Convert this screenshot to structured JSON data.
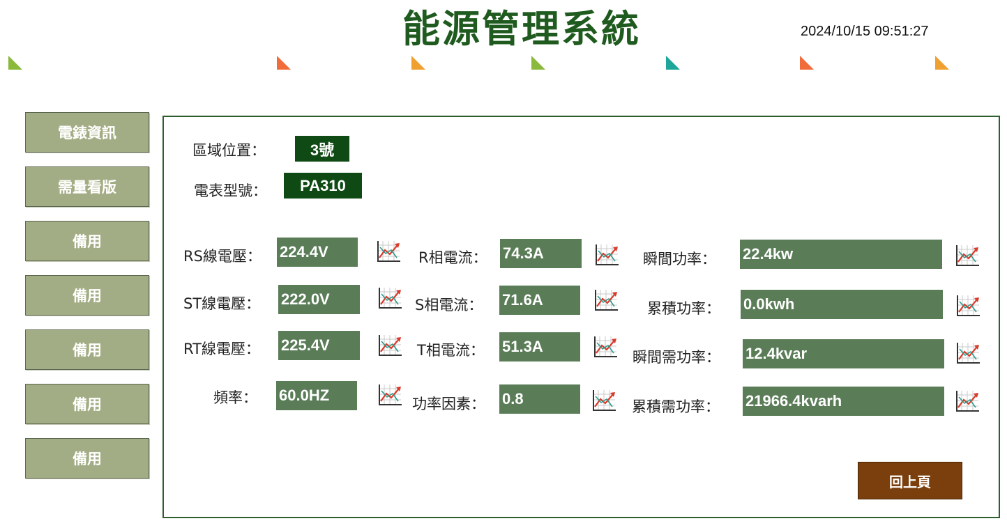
{
  "header": {
    "title": "能源管理系統",
    "datetime": "2024/10/15 09:51:27",
    "triangle_colors": [
      "#8ab93c",
      "#f26b3a",
      "#f0a030",
      "#8ab93c",
      "#1fa69a",
      "#f26b3a",
      "#f0a030"
    ]
  },
  "sidebar": {
    "items": [
      {
        "label": "電錶資訊"
      },
      {
        "label": "需量看版"
      },
      {
        "label": "備用"
      },
      {
        "label": "備用"
      },
      {
        "label": "備用"
      },
      {
        "label": "備用"
      },
      {
        "label": "備用"
      }
    ]
  },
  "info": {
    "area_label": "區域位置：",
    "area_value": "3號",
    "model_label": "電表型號：",
    "model_value": "PA310"
  },
  "readings": {
    "rs_voltage": {
      "label": "RS線電壓：",
      "value": "224.4V"
    },
    "st_voltage": {
      "label": "ST線電壓：",
      "value": "222.0V"
    },
    "rt_voltage": {
      "label": "RT線電壓：",
      "value": "225.4V"
    },
    "frequency": {
      "label": "頻率：",
      "value": "60.0HZ"
    },
    "r_current": {
      "label": "R相電流：",
      "value": "74.3A"
    },
    "s_current": {
      "label": "S相電流：",
      "value": "71.6A"
    },
    "t_current": {
      "label": "T相電流：",
      "value": "51.3A"
    },
    "power_factor": {
      "label": "功率因素：",
      "value": "0.8"
    },
    "inst_power": {
      "label": "瞬間功率：",
      "value": "22.4kw"
    },
    "accum_power": {
      "label": "累積功率：",
      "value": "0.0kwh"
    },
    "inst_demand": {
      "label": "瞬間需功率：",
      "value": "12.4kvar"
    },
    "accum_demand": {
      "label": "累積需功率：",
      "value": "21966.4kvarh"
    }
  },
  "buttons": {
    "back": "回上頁"
  },
  "colors": {
    "title_green": "#1f5a1f",
    "sidebar_bg": "#a3ad85",
    "value_bg": "#5a7d58",
    "dark_box_bg": "#0f4a14",
    "back_btn_bg": "#7a3f0d"
  }
}
